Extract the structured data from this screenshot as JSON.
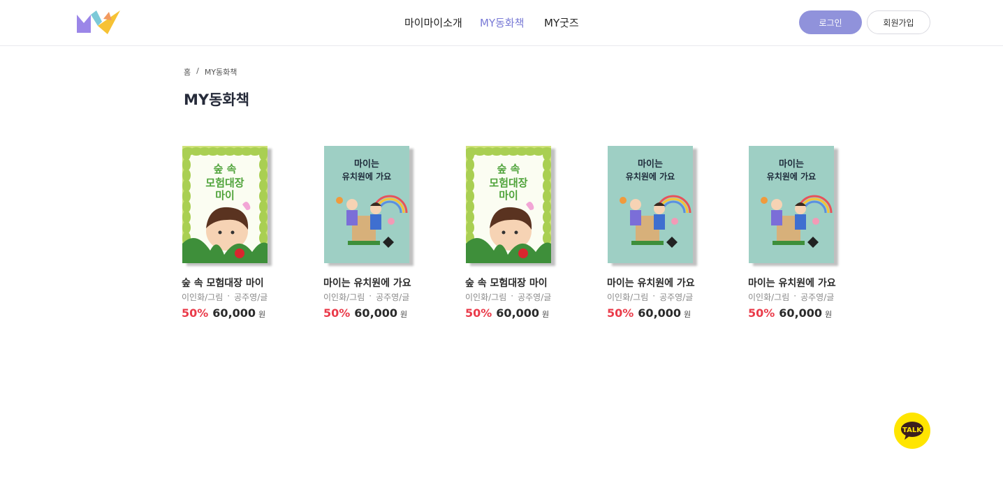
{
  "header": {
    "nav": [
      "마이마이소개",
      "MY동화책",
      "MY굿즈"
    ],
    "login_label": "로그인",
    "join_label": "회원가입",
    "logo_colors": [
      "#9b86e8",
      "#7cc9d8",
      "#f6c234"
    ]
  },
  "breadcrumb": {
    "home": "홈",
    "separator": "/",
    "current": "MY동화책"
  },
  "page_title": "MY동화책",
  "products": [
    {
      "title": "숲 속 모험대장 마이",
      "illustrator": "이인화/그림",
      "writer": "공주영/글",
      "discount": "50%",
      "price": "60,000",
      "unit": "원",
      "cover": "forest"
    },
    {
      "title": "마이는 유치원에 가요",
      "illustrator": "이인화/그림",
      "writer": "공주영/글",
      "discount": "50%",
      "price": "60,000",
      "unit": "원",
      "cover": "kinder"
    },
    {
      "title": "숲 속 모험대장 마이",
      "illustrator": "이인화/그림",
      "writer": "공주영/글",
      "discount": "50%",
      "price": "60,000",
      "unit": "원",
      "cover": "forest"
    },
    {
      "title": "마이는 유치원에 가요",
      "illustrator": "이인화/그림",
      "writer": "공주영/글",
      "discount": "50%",
      "price": "60,000",
      "unit": "원",
      "cover": "kinder"
    },
    {
      "title": "마이는 유치원에 가요",
      "illustrator": "이인화/그림",
      "writer": "공주영/글",
      "discount": "50%",
      "price": "60,000",
      "unit": "원",
      "cover": "kinder"
    }
  ],
  "covers": {
    "forest": {
      "line1": "숲 속",
      "line2": "모험대장",
      "line3": "마이"
    },
    "kinder": {
      "line1": "마이는",
      "line2": "유치원에 가요"
    }
  },
  "bullet": "·",
  "talk_label": "TALK",
  "colors": {
    "accent": "#9092db",
    "discount": "#ea3b4a",
    "talk": "#ffe500"
  }
}
